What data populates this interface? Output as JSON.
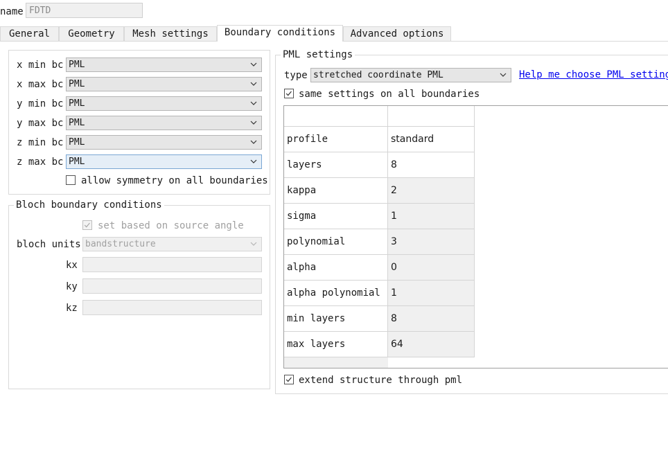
{
  "name_field": {
    "label": "name",
    "value": "FDTD"
  },
  "tabs": [
    {
      "label": "General"
    },
    {
      "label": "Geometry"
    },
    {
      "label": "Mesh settings"
    },
    {
      "label": "Boundary conditions"
    },
    {
      "label": "Advanced options"
    }
  ],
  "active_tab": "Boundary conditions",
  "boundaries": {
    "rows": [
      {
        "label": "x min bc",
        "value": "PML"
      },
      {
        "label": "x max bc",
        "value": "PML"
      },
      {
        "label": "y min bc",
        "value": "PML"
      },
      {
        "label": "y max bc",
        "value": "PML"
      },
      {
        "label": "z min bc",
        "value": "PML"
      },
      {
        "label": "z max bc",
        "value": "PML"
      }
    ],
    "allow_symmetry_label": "allow symmetry on all boundaries",
    "allow_symmetry_checked": false
  },
  "bloch": {
    "title": "Bloch boundary conditions",
    "set_based_label": "set based on source angle",
    "set_based_checked": true,
    "units_label": "bloch units",
    "units_value": "bandstructure",
    "kx_label": "kx",
    "ky_label": "ky",
    "kz_label": "kz",
    "kx_value": "",
    "ky_value": "",
    "kz_value": ""
  },
  "pml": {
    "title": "PML settings",
    "type_label": "type",
    "type_value": "stretched coordinate PML",
    "help_link": "Help me choose PML settings",
    "same_settings_label": "same settings on all boundaries",
    "same_settings_checked": true,
    "table_rows": [
      {
        "name": "profile",
        "value": "standard"
      },
      {
        "name": "layers",
        "value": "8"
      },
      {
        "name": "kappa",
        "value": "2"
      },
      {
        "name": "sigma",
        "value": "1"
      },
      {
        "name": "polynomial",
        "value": "3"
      },
      {
        "name": "alpha",
        "value": "0"
      },
      {
        "name": "alpha polynomial",
        "value": "1"
      },
      {
        "name": "min layers",
        "value": "8"
      },
      {
        "name": "max layers",
        "value": "64"
      }
    ],
    "extend_label": "extend structure through pml",
    "extend_checked": true
  },
  "colors": {
    "link": "#0000ee",
    "focused_select_border": "#7aa7d4",
    "panel_border": "#d9d9d9"
  },
  "icons": {
    "dropdown": "chevron-down-icon",
    "check": "checkmark-icon"
  }
}
